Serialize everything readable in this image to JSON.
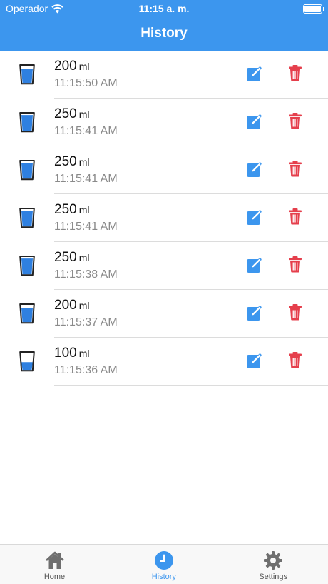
{
  "status_bar": {
    "carrier": "Operador",
    "time": "11:15 a. m."
  },
  "nav": {
    "title": "History"
  },
  "entries": [
    {
      "amount": "200",
      "unit": "ml",
      "time": "11:15:50 AM",
      "fill": 0.78
    },
    {
      "amount": "250",
      "unit": "ml",
      "time": "11:15:41 AM",
      "fill": 0.88
    },
    {
      "amount": "250",
      "unit": "ml",
      "time": "11:15:41 AM",
      "fill": 0.88
    },
    {
      "amount": "250",
      "unit": "ml",
      "time": "11:15:41 AM",
      "fill": 0.88
    },
    {
      "amount": "250",
      "unit": "ml",
      "time": "11:15:38 AM",
      "fill": 0.88
    },
    {
      "amount": "200",
      "unit": "ml",
      "time": "11:15:37 AM",
      "fill": 0.78
    },
    {
      "amount": "100",
      "unit": "ml",
      "time": "11:15:36 AM",
      "fill": 0.45
    }
  ],
  "tabs": [
    {
      "label": "Home",
      "icon": "home-icon",
      "active": false
    },
    {
      "label": "History",
      "icon": "clock-icon",
      "active": true
    },
    {
      "label": "Settings",
      "icon": "gear-icon",
      "active": false
    }
  ],
  "colors": {
    "accent": "#3c96ee",
    "water": "#2f80e0",
    "delete": "#e53f4c"
  }
}
